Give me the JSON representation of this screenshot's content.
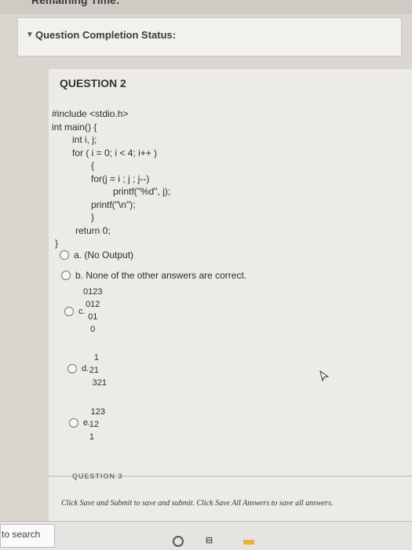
{
  "header": {
    "partial_title": "Remaining Time:",
    "status_label": "Question Completion Status:"
  },
  "question": {
    "title": "QUESTION 2",
    "code_lines": [
      "#include <stdio.h>",
      "int main() {",
      "int i, j;",
      "for ( i = 0; i < 4; i++ )",
      "{",
      "for(j = i ; j ; j--)",
      "printf(\"%d\", j);",
      "printf(\"\\n\");",
      "}",
      "return 0;",
      "}"
    ],
    "options": {
      "a": {
        "letter": "a.",
        "text": "(No Output)"
      },
      "b": {
        "letter": "b.",
        "text": "None of the other answers are correct."
      },
      "c": {
        "letter": "c.",
        "lines": [
          "0123",
          "012",
          "01",
          "0"
        ]
      },
      "d": {
        "letter": "d.",
        "lines": [
          "1",
          "21",
          "321"
        ]
      },
      "e": {
        "letter": "e.",
        "lines": [
          "123",
          "12",
          "1"
        ]
      }
    }
  },
  "footer": {
    "next_hint": "QUESTION 3",
    "submit_hint": "Click Save and Submit to save and submit. Click Save All Answers to save all answers."
  },
  "taskbar": {
    "search_text": "to search"
  }
}
